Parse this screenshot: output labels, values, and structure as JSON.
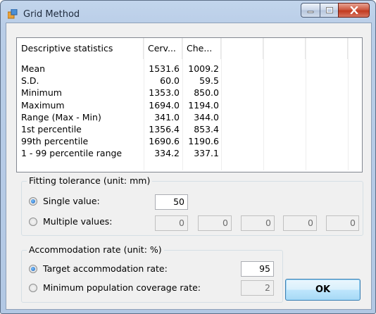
{
  "window": {
    "title": "Grid Method",
    "icon": "app-window-icon"
  },
  "caption_buttons": {
    "minimize": "minimize-icon",
    "maximize": "maximize-icon",
    "close": "close-icon"
  },
  "table": {
    "headers": [
      "Descriptive statistics",
      "Cerv...",
      "Che..."
    ],
    "rows": [
      [
        "Mean",
        "1531.6",
        "1009.2"
      ],
      [
        "S.D.",
        "60.0",
        "59.5"
      ],
      [
        "Minimum",
        "1353.0",
        "850.0"
      ],
      [
        "Maximum",
        "1694.0",
        "1194.0"
      ],
      [
        "Range (Max - Min)",
        "341.0",
        "344.0"
      ],
      [
        "1st percentile",
        "1356.4",
        "853.4"
      ],
      [
        "99th percentile",
        "1690.6",
        "1190.6"
      ],
      [
        "1 - 99 percentile range",
        "334.2",
        "337.1"
      ]
    ]
  },
  "fitting": {
    "label": "Fitting tolerance (unit: mm)",
    "single_label": "Single value:",
    "single_value": "50",
    "multiple_label": "Multiple values:",
    "multiple_values": [
      "0",
      "0",
      "0",
      "0",
      "0"
    ],
    "selected": "single"
  },
  "accommodation": {
    "label": "Accommodation rate (unit: %)",
    "target_label": "Target accommodation rate:",
    "target_value": "95",
    "min_label": "Minimum population coverage rate:",
    "min_value": "2",
    "selected": "target"
  },
  "ok_label": "OK",
  "colors": {
    "frame": "#b9cde7",
    "client": "#f0f0f0",
    "close_button": "#c23a1f",
    "accent": "#3c7fb1"
  }
}
